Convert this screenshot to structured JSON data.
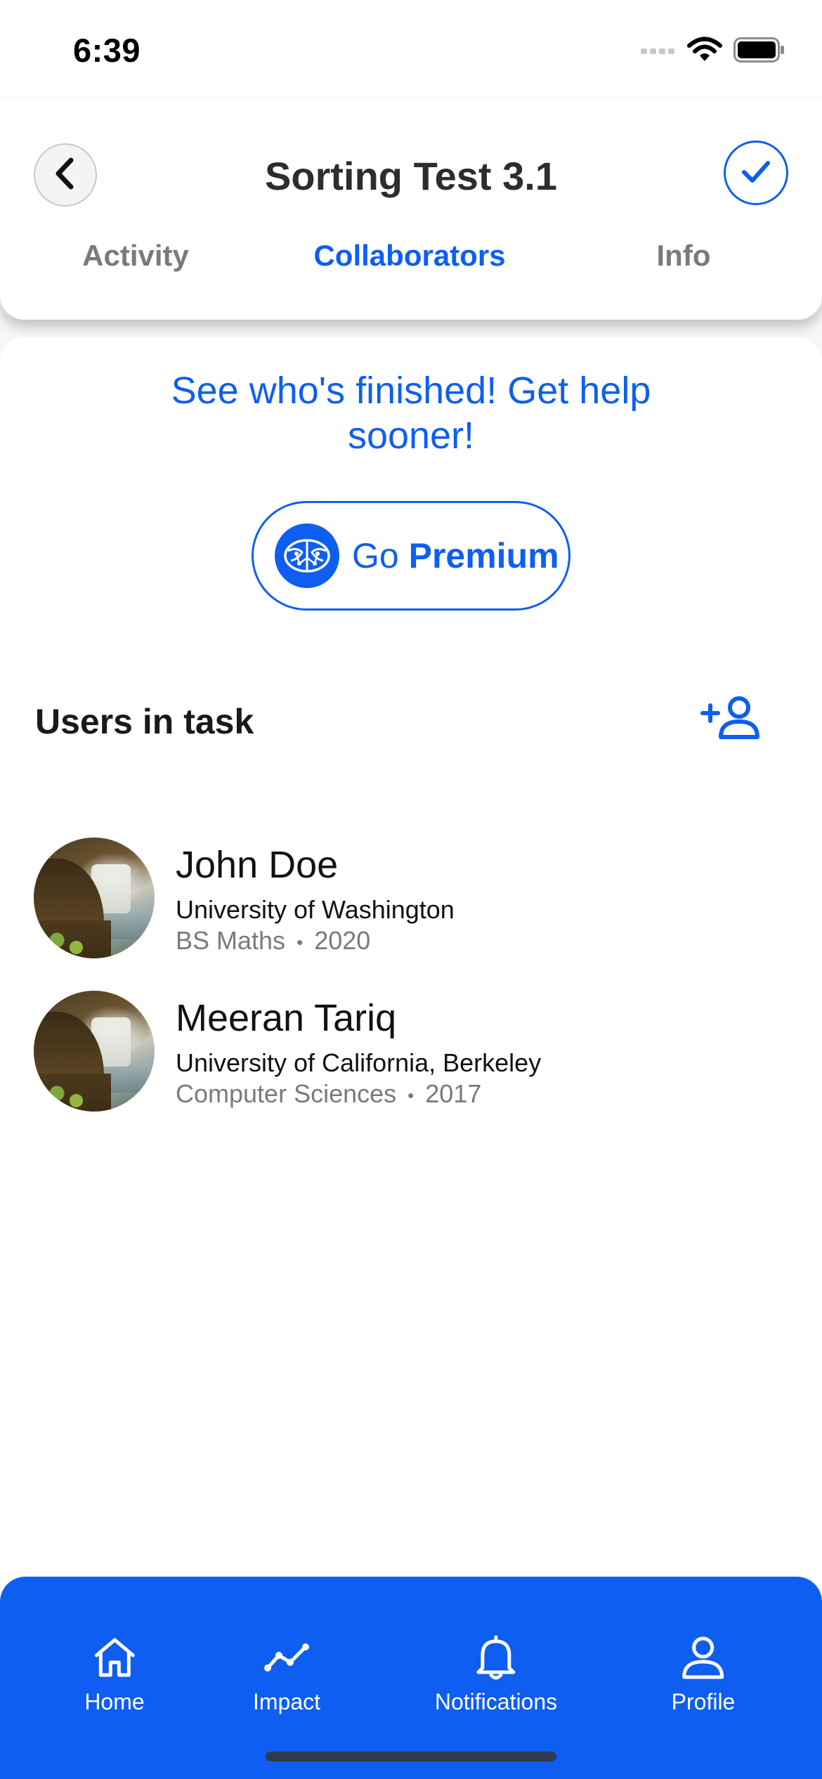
{
  "status_bar": {
    "time": "6:39",
    "icons": [
      "signal-icon",
      "wifi-icon",
      "battery-icon"
    ]
  },
  "header": {
    "title": "Sorting Test 3.1",
    "back_icon": "chevron-left-icon",
    "done_icon": "checkmark-icon",
    "tabs": [
      {
        "label": "Activity",
        "active": false
      },
      {
        "label": "Collaborators",
        "active": true
      },
      {
        "label": "Info",
        "active": false
      }
    ]
  },
  "promo": {
    "text": "See who's finished! Get help sooner!",
    "button_prefix": "Go",
    "button_emphasis": "Premium",
    "button_icon": "brain-icon"
  },
  "users_section": {
    "title": "Users in task",
    "add_icon": "add-user-icon",
    "users": [
      {
        "name": "John Doe",
        "school": "University of Washington",
        "program": "BS Maths",
        "year": "2020"
      },
      {
        "name": "Meeran Tariq",
        "school": "University of California, Berkeley",
        "program": "Computer Sciences",
        "year": "2017"
      }
    ],
    "separator": "•"
  },
  "bottom_nav": {
    "items": [
      {
        "label": "Home",
        "icon": "home-icon"
      },
      {
        "label": "Impact",
        "icon": "trend-line-icon"
      },
      {
        "label": "Notifications",
        "icon": "bell-icon"
      },
      {
        "label": "Profile",
        "icon": "person-icon"
      }
    ]
  },
  "colors": {
    "accent": "#0f5ef2",
    "title_text": "#2d2d2d",
    "muted_text": "#7a7a7a",
    "nav_background": "#0f5ef2"
  }
}
